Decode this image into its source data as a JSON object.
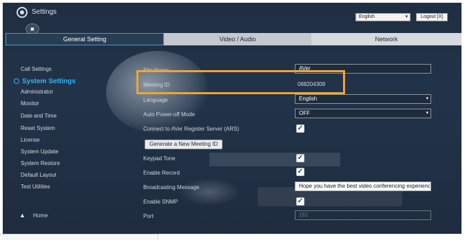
{
  "app": {
    "title": "Settings"
  },
  "header": {
    "language": "English",
    "logout": "Logout [X]"
  },
  "tabs": [
    {
      "label": "General Setting",
      "active": true
    },
    {
      "label": "Video / Audio",
      "active": false
    },
    {
      "label": "Network",
      "active": false
    }
  ],
  "sidebar": {
    "items": [
      {
        "label": "Call Settings"
      },
      {
        "label": "System Settings"
      },
      {
        "label": "Administrator"
      },
      {
        "label": "Monitor"
      },
      {
        "label": "Date and Time"
      },
      {
        "label": "Reset System"
      },
      {
        "label": "License"
      },
      {
        "label": "System Update"
      },
      {
        "label": "System Restore"
      },
      {
        "label": "Default Layout"
      },
      {
        "label": "Test Utilities"
      }
    ],
    "home": "Home"
  },
  "settings": {
    "site_name": {
      "label": "Site Name",
      "value": "AVer"
    },
    "meeting_id": {
      "label": "Meeting ID",
      "value": "068204309"
    },
    "language": {
      "label": "Language",
      "value": "English"
    },
    "auto_power_off": {
      "label": "Auto Power-off Mode",
      "value": "OFF"
    },
    "ars": {
      "label": "Connect to AVer Register Server (ARS)",
      "checked": true
    },
    "generate_button": "Generate a New Meeting ID",
    "keypad_tone": {
      "label": "Keypad Tone",
      "checked": true
    },
    "enable_record": {
      "label": "Enable Record",
      "checked": true
    },
    "broadcasting_message": {
      "label": "Broadcasting Message",
      "value": "Hope you have the best video conferencing experience"
    },
    "enable_snmp": {
      "label": "Enable SNMP",
      "checked": true
    },
    "port": {
      "label": "Port",
      "value": "161"
    }
  },
  "icons": {
    "settings": "gear-icon",
    "camera": "camera-off-icon",
    "home": "home-icon",
    "checkbox": "checkmark-icon"
  },
  "colors": {
    "accent": "#35b4f0",
    "highlight": "#f3a52a",
    "background": "#223349"
  }
}
